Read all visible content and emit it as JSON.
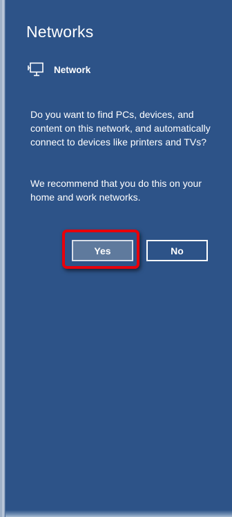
{
  "pane": {
    "title": "Networks",
    "network_name": "Network",
    "network_icon": "monitor-network-icon",
    "question": "Do you want to find PCs, devices, and content on this network, and automatically connect to devices like printers and TVs?",
    "recommendation": "We recommend that you do this on your home and work networks."
  },
  "buttons": {
    "yes_label": "Yes",
    "no_label": "No"
  },
  "colors": {
    "background": "#2d5388",
    "highlight": "#e8000b",
    "yes_button": "#5f7a9d"
  }
}
